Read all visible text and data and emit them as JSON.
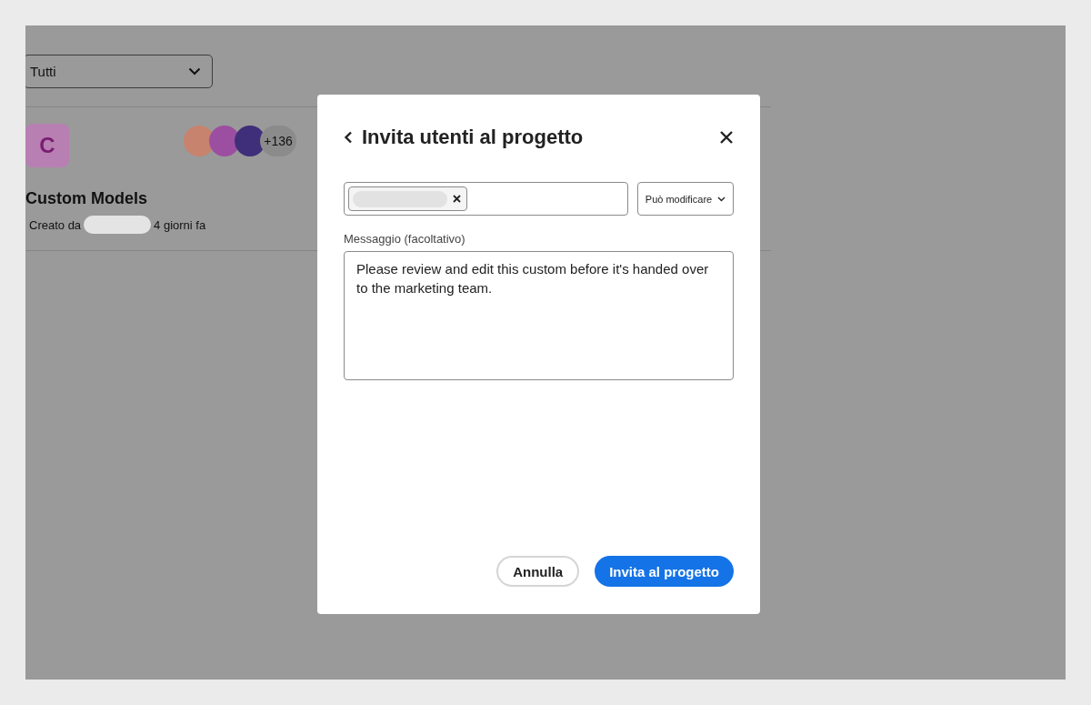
{
  "background": {
    "filter": {
      "value": "Tutti"
    },
    "project": {
      "initial": "C",
      "member_count": "+136",
      "title": "Custom Models",
      "created_by_label": "Creato da",
      "age": "4 giorni fa"
    }
  },
  "dialog": {
    "title": "Invita utenti al progetto",
    "permission": "Può modificare",
    "message_label": "Messaggio (facoltativo)",
    "message": "Please review and edit this custom before it's handed over to the marketing team.",
    "buttons": [
      {
        "label": "Annulla",
        "kind": "secondary"
      },
      {
        "label": "Invita al progetto",
        "kind": "primary"
      }
    ]
  }
}
